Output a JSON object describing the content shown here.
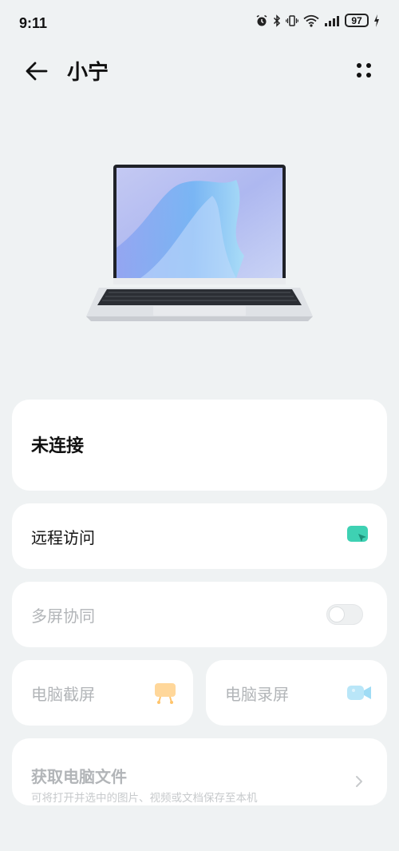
{
  "status_bar": {
    "time": "9:11",
    "battery": "97",
    "icons": [
      "alarm-icon",
      "bluetooth-icon",
      "vibrate-icon",
      "wifi-icon",
      "signal-icon",
      "battery-icon",
      "charging-icon"
    ]
  },
  "header": {
    "title": "小宁",
    "back_icon": "back-arrow-icon",
    "more_icon": "more-dots-icon"
  },
  "device": {
    "image": "laptop-image"
  },
  "connection": {
    "status": "未连接"
  },
  "features": {
    "remote_access": {
      "label": "远程访问",
      "icon": "remote-access-icon",
      "color": "#3ed1b3"
    },
    "multi_screen": {
      "label": "多屏协同",
      "toggle": false
    },
    "pc_screenshot": {
      "label": "电脑截屏",
      "icon": "screenshot-icon",
      "color": "#ffd79a"
    },
    "pc_record": {
      "label": "电脑录屏",
      "icon": "record-icon",
      "color": "#b9e6f8"
    },
    "get_files": {
      "label": "获取电脑文件",
      "description": "可将打开并选中的图片、视频或文档保存至本机"
    }
  },
  "colors": {
    "background": "#eff2f3",
    "card": "#ffffff",
    "disabled_text": "#b2b5b8",
    "accent": "#3ed1b3"
  }
}
